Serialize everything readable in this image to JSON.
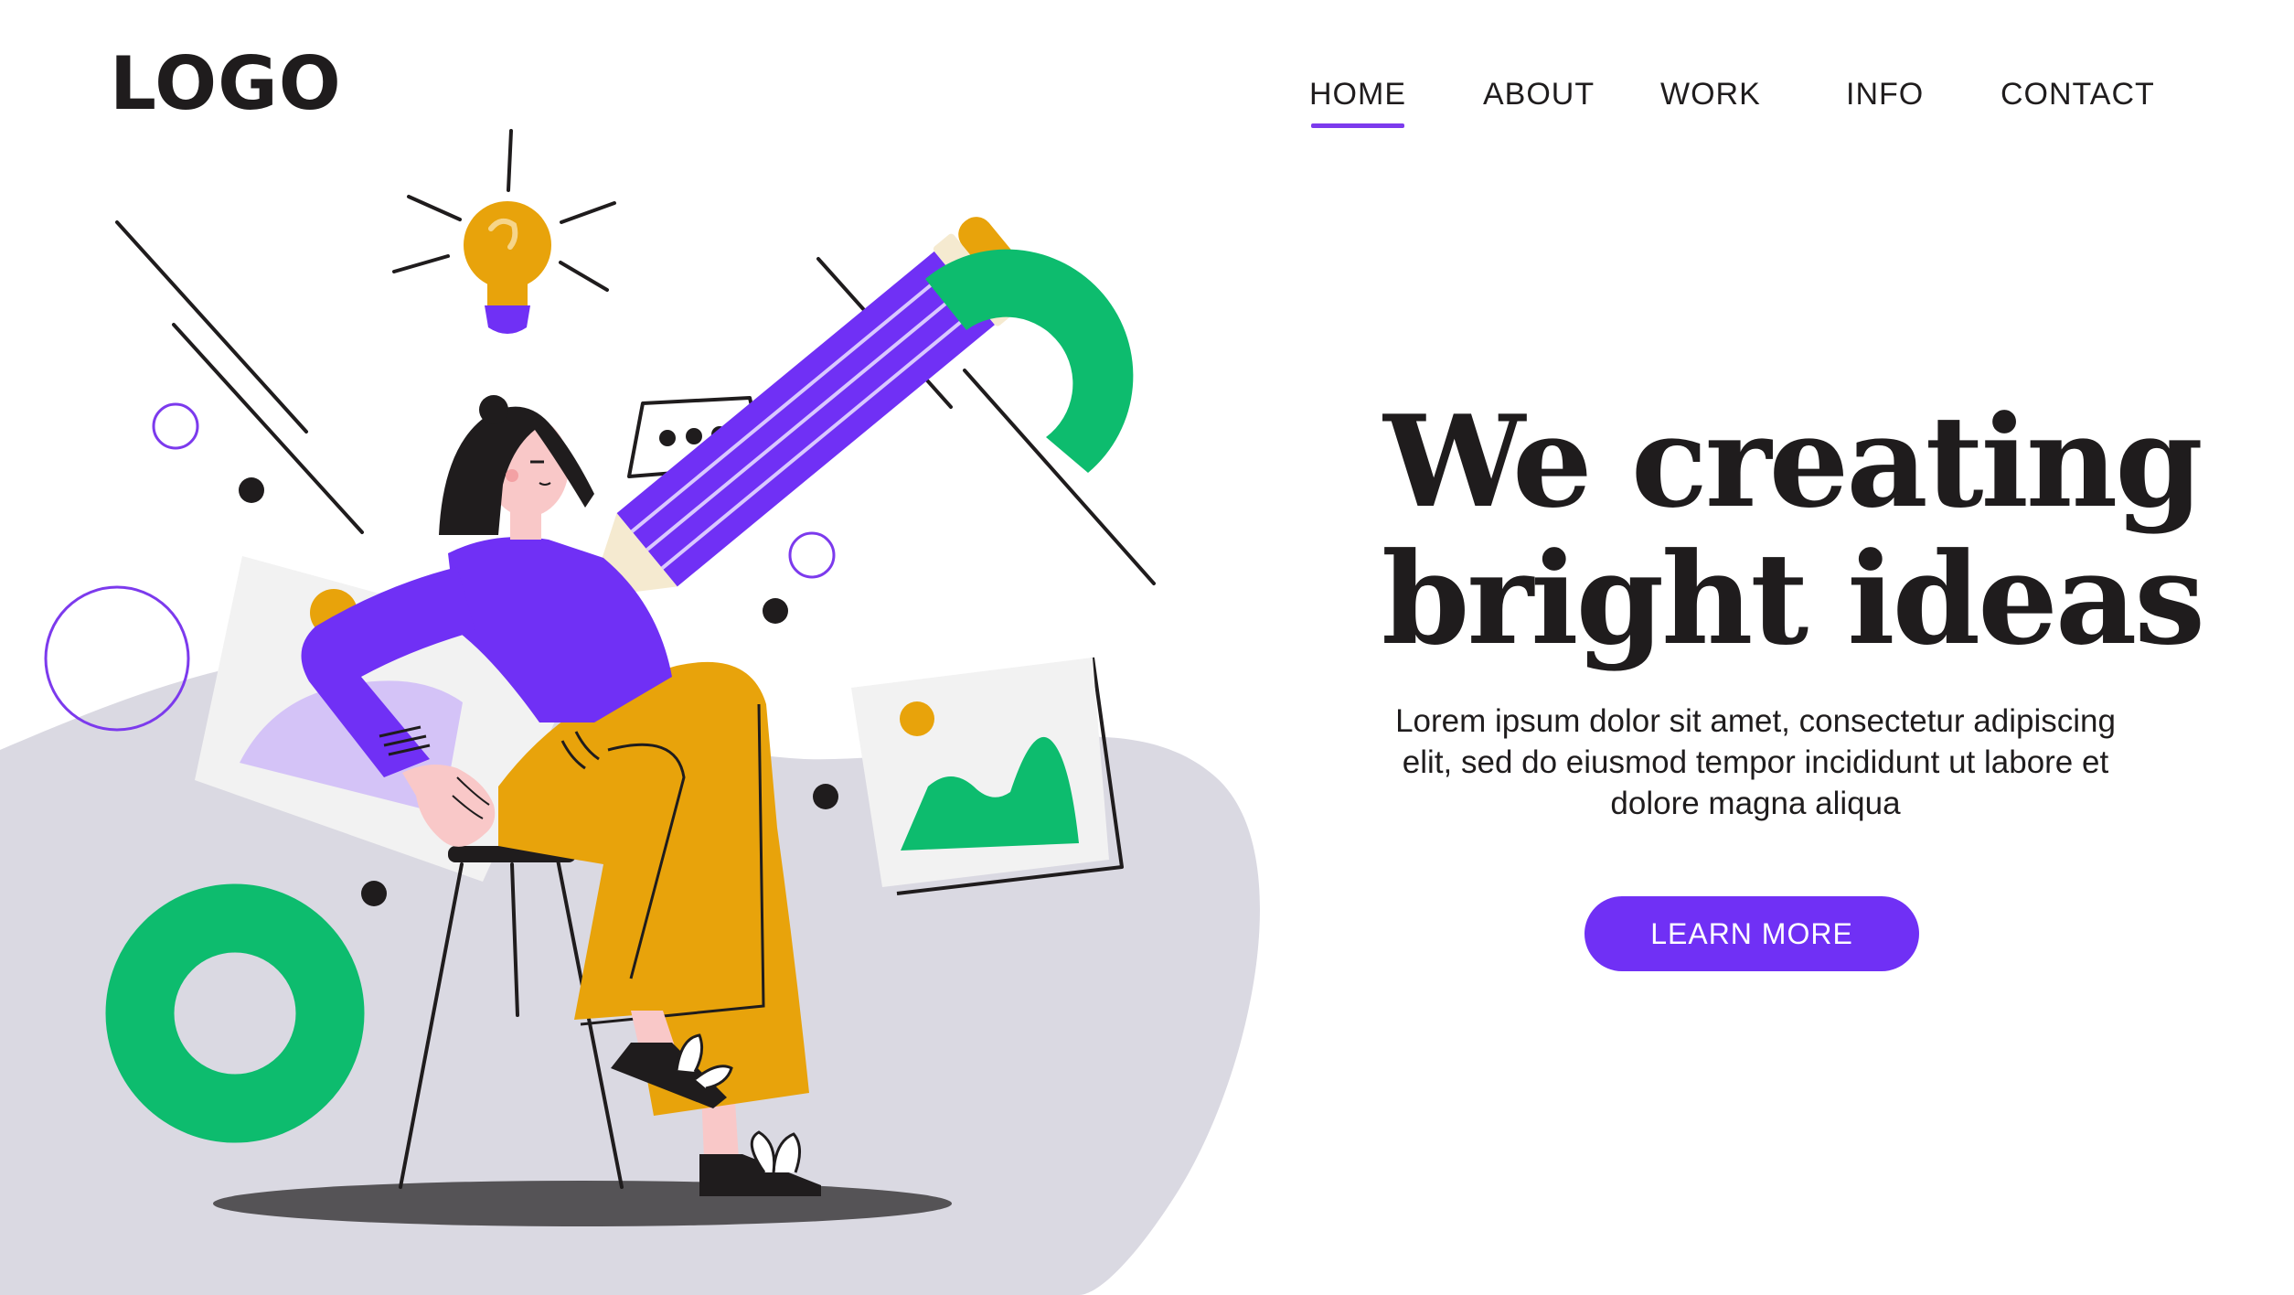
{
  "header": {
    "logo": "LOGO",
    "nav": [
      {
        "label": "HOME",
        "active": true
      },
      {
        "label": "ABOUT",
        "active": false
      },
      {
        "label": "WORK",
        "active": false
      },
      {
        "label": "INFO",
        "active": false
      },
      {
        "label": "CONTACT",
        "active": false
      }
    ]
  },
  "hero": {
    "title_line1": "We creating",
    "title_line2": "bright ideas",
    "body_line1": "Lorem ipsum dolor sit amet, consectetur adipiscing",
    "body_line2": "elit, sed do eiusmod tempor incididunt ut labore et",
    "body_line3": "dolore magna aliqua",
    "cta_label": "LEARN MORE"
  },
  "colors": {
    "accent": "#7030f5",
    "green": "#0dbc6e",
    "orange": "#e8a30b",
    "blob": "#dad9e2",
    "text": "#1f1c1d"
  }
}
